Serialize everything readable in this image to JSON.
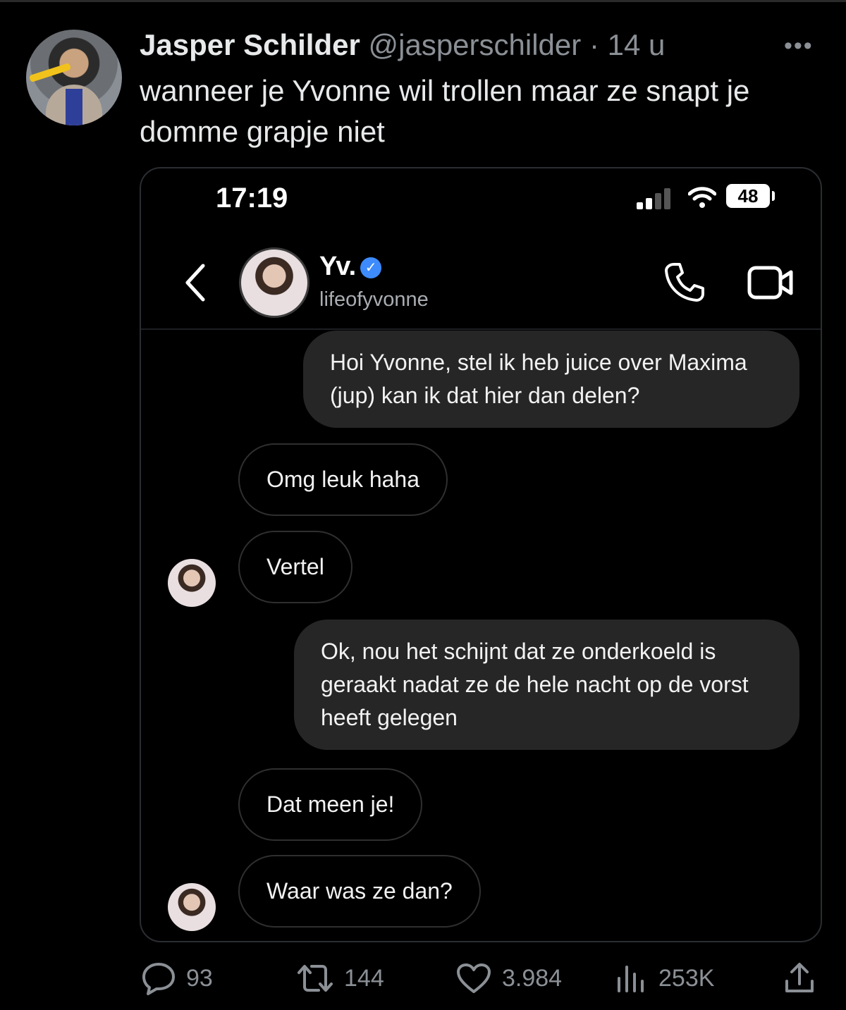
{
  "tweet": {
    "author_name": "Jasper Schilder",
    "handle": "@jasperschilder",
    "separator": "·",
    "time": "14 u",
    "more": "•••",
    "text": "wanneer je Yvonne wil trollen maar ze snapt je domme grapje niet"
  },
  "screenshot": {
    "status_time": "17:19",
    "battery": "48",
    "contact_name": "Yv.",
    "contact_handle": "lifeofyvonne",
    "messages": [
      {
        "from": "me",
        "text": "Hoi Yvonne, stel ik heb juice over Maxima (jup) kan ik dat hier dan delen?"
      },
      {
        "from": "them",
        "text": "Omg leuk haha"
      },
      {
        "from": "them",
        "text": "Vertel"
      },
      {
        "from": "me",
        "text": "Ok, nou het schijnt dat ze onderkoeld is geraakt nadat ze de hele nacht op de vorst heeft gelegen"
      },
      {
        "from": "them",
        "text": "Dat meen je!"
      },
      {
        "from": "them",
        "text": "Waar was ze dan?"
      }
    ]
  },
  "actions": {
    "replies": "93",
    "retweets": "144",
    "likes": "3.984",
    "views": "253K"
  },
  "icons": [
    "reply-icon",
    "retweet-icon",
    "like-icon",
    "views-icon",
    "share-icon",
    "phone-icon",
    "video-icon",
    "back-chevron-icon",
    "verified-badge-icon",
    "wifi-icon",
    "signal-icon",
    "battery-icon"
  ],
  "colors": {
    "background": "#000000",
    "text": "#e7e9ea",
    "muted": "#8b9096",
    "bubble_out": "#262626",
    "verified": "#3d8bfd"
  }
}
